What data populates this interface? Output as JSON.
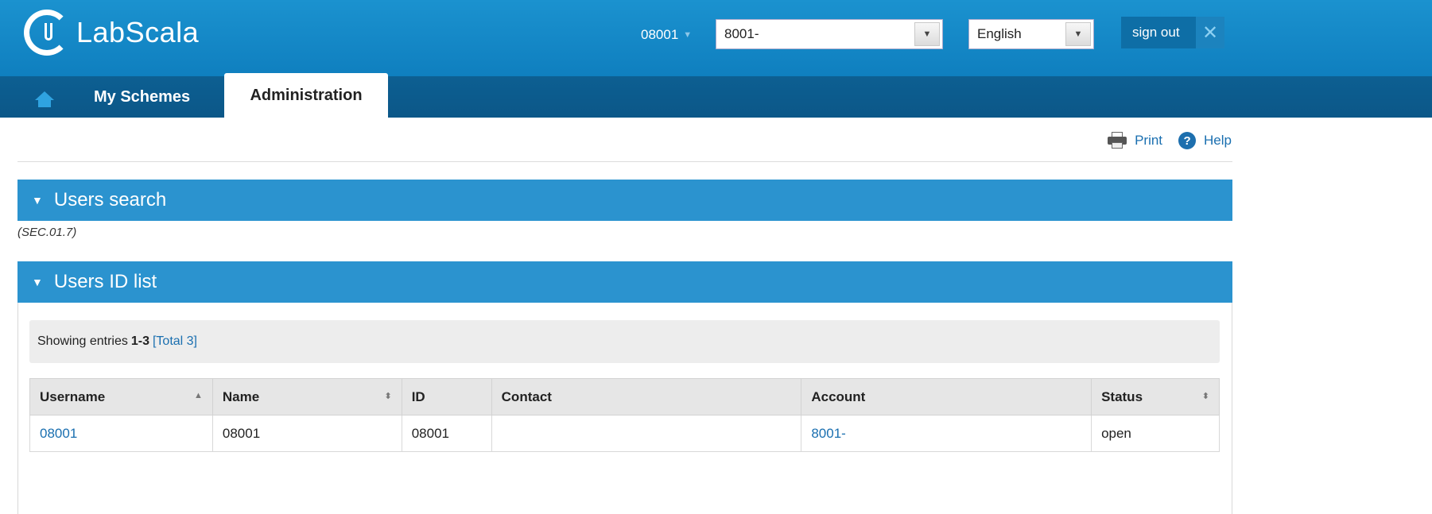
{
  "app": {
    "name": "LabScala"
  },
  "header": {
    "account_code": "08001",
    "account_select": "8001-",
    "language_select": "English",
    "sign_out_label": "sign out",
    "close_glyph": "✕"
  },
  "nav": {
    "home_icon": "home-icon",
    "tabs": [
      {
        "label": "My Schemes",
        "active": false
      },
      {
        "label": "Administration",
        "active": true
      }
    ]
  },
  "toolbar": {
    "print_label": "Print",
    "help_label": "Help"
  },
  "panels": {
    "search": {
      "title": "Users search",
      "code": "(SEC.01.7)"
    },
    "list": {
      "title": "Users ID list"
    }
  },
  "list": {
    "showing_prefix": "Showing entries",
    "range": "1-3",
    "total_label": "[Total 3]",
    "columns": [
      "Username",
      "Name",
      "ID",
      "Contact",
      "Account",
      "Status"
    ],
    "rows": [
      {
        "username": "08001",
        "name": "08001",
        "id": "08001",
        "contact": "",
        "account": "8001-",
        "status": "open"
      }
    ]
  },
  "colors": {
    "header_blue": "#1b92cf",
    "nav_dark_blue": "#0d5f92",
    "panel_blue": "#2b93cf",
    "link_blue": "#1a6fb0"
  }
}
